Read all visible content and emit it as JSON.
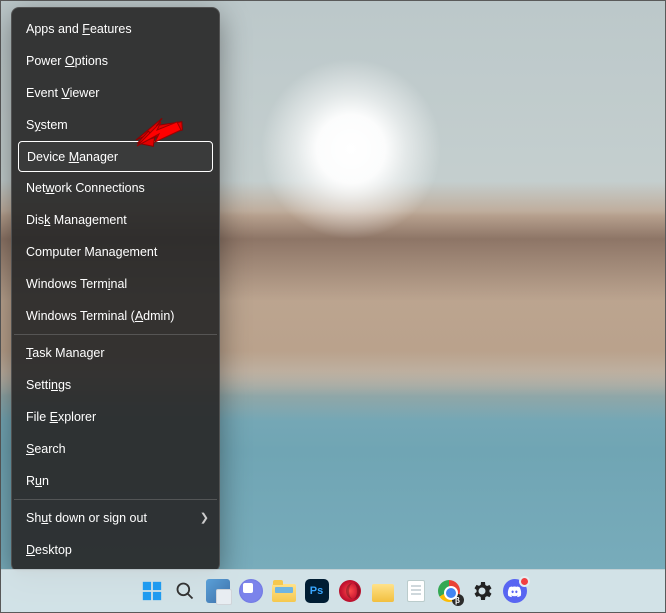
{
  "menu": {
    "groups": [
      [
        {
          "pre": "Apps and ",
          "u": "F",
          "post": "eatures"
        },
        {
          "pre": "Power ",
          "u": "O",
          "post": "ptions"
        },
        {
          "pre": "Event ",
          "u": "V",
          "post": "iewer"
        },
        {
          "pre": "S",
          "u": "y",
          "post": "stem"
        },
        {
          "pre": "Device ",
          "u": "M",
          "post": "anager",
          "highlight": true
        },
        {
          "pre": "Net",
          "u": "w",
          "post": "ork Connections"
        },
        {
          "pre": "Dis",
          "u": "k",
          "post": " Management"
        },
        {
          "pre": "Computer Mana",
          "u": "g",
          "post": "ement"
        },
        {
          "pre": "Windows Term",
          "u": "i",
          "post": "nal"
        },
        {
          "pre": "Windows Terminal (",
          "u": "A",
          "post": "dmin)"
        }
      ],
      [
        {
          "pre": "",
          "u": "T",
          "post": "ask Manager"
        },
        {
          "pre": "Setti",
          "u": "n",
          "post": "gs"
        },
        {
          "pre": "File ",
          "u": "E",
          "post": "xplorer"
        },
        {
          "pre": "",
          "u": "S",
          "post": "earch"
        },
        {
          "pre": "R",
          "u": "u",
          "post": "n"
        }
      ],
      [
        {
          "pre": "Sh",
          "u": "u",
          "post": "t down or sign out",
          "submenu": true
        },
        {
          "pre": "",
          "u": "D",
          "post": "esktop"
        }
      ]
    ]
  },
  "taskbar": {
    "items": [
      "start-icon",
      "search-icon",
      "task-view-icon",
      "chat-icon",
      "file-explorer-icon",
      "photoshop-icon",
      "opera-icon",
      "folder-icon",
      "notepad-icon",
      "chrome-beta-icon",
      "settings-icon",
      "discord-icon"
    ],
    "ps_label": "Ps",
    "chrome_beta_badge": "β"
  },
  "annotation": {
    "arrow_color": "#ff0000",
    "arrow_target": "Device Manager"
  }
}
